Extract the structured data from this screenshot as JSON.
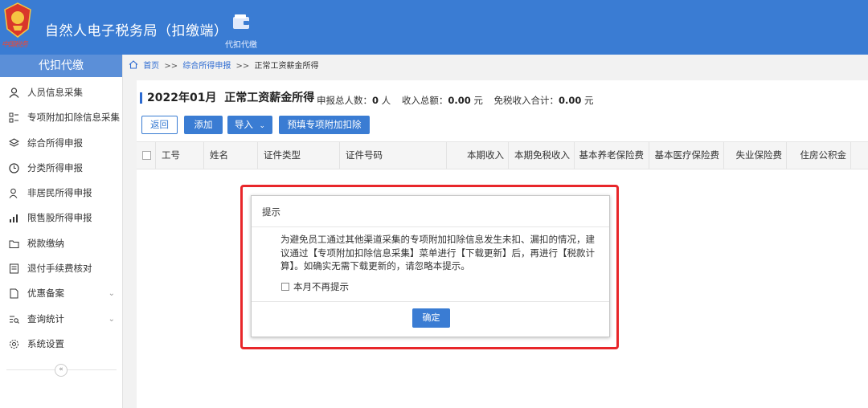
{
  "header": {
    "app_title": "自然人电子税务局（扣缴端）",
    "logo_text": "中国税务",
    "nav_tab": "代扣代缴"
  },
  "sidebar": {
    "title": "代扣代缴",
    "items": [
      {
        "label": "人员信息采集",
        "icon": "user-icon"
      },
      {
        "label": "专项附加扣除信息采集",
        "icon": "grid-icon"
      },
      {
        "label": "综合所得申报",
        "icon": "layers-icon"
      },
      {
        "label": "分类所得申报",
        "icon": "clock-icon"
      },
      {
        "label": "非居民所得申报",
        "icon": "person-icon"
      },
      {
        "label": "限售股所得申报",
        "icon": "bar-chart-icon"
      },
      {
        "label": "税款缴纳",
        "icon": "folder-icon"
      },
      {
        "label": "退付手续费核对",
        "icon": "document-icon"
      },
      {
        "label": "优惠备案",
        "icon": "file-icon"
      },
      {
        "label": "查询统计",
        "icon": "search-list-icon"
      },
      {
        "label": "系统设置",
        "icon": "gear-icon"
      }
    ]
  },
  "breadcrumb": {
    "home": "首页",
    "sep": ">>",
    "level1": "综合所得申报",
    "current": "正常工资薪金所得"
  },
  "main": {
    "title": "2022年01月  正常工资薪金所得",
    "stats": {
      "count_label": "申报总人数：",
      "count_value": "0",
      "count_unit": "人",
      "income_label": "收入总额：",
      "income_value": "0.00",
      "income_unit": "元",
      "taxfree_label": "免税收入合计：",
      "taxfree_value": "0.00",
      "taxfree_unit": "元"
    },
    "buttons": {
      "back": "返回",
      "add": "添加",
      "import": "导入",
      "prefill": "预填专项附加扣除"
    },
    "table_headers": [
      "工号",
      "姓名",
      "证件类型",
      "证件号码",
      "本期收入",
      "本期免税收入",
      "基本养老保险费",
      "基本医疗保险费",
      "失业保险费",
      "住房公积金"
    ]
  },
  "dialog": {
    "title": "提示",
    "message": "为避免员工通过其他渠道采集的专项附加扣除信息发生未扣、漏扣的情况，建议通过【专项附加扣除信息采集】菜单进行【下载更新】后，再进行【税款计算】。如确实无需下载更新的，请忽略本提示。",
    "checkbox_label": "本月不再提示",
    "ok": "确定"
  },
  "colors": {
    "primary": "#3a7cd3",
    "highlight": "#e8262a"
  }
}
